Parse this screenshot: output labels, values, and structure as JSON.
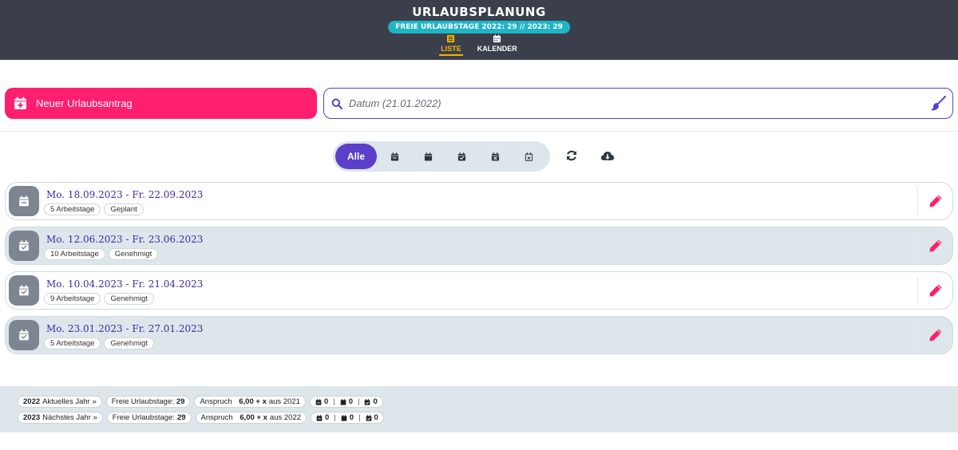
{
  "header": {
    "title": "URLAUBSPLANUNG",
    "badge": "FREIE URLAUBSTAGE 2022: 29 // 2023: 29",
    "nav": [
      {
        "label": "LISTE",
        "icon": "list-icon",
        "active": true
      },
      {
        "label": "KALENDER",
        "icon": "calendar-icon",
        "active": false
      }
    ]
  },
  "toolbar": {
    "new_label": "Neuer Urlaubsantrag",
    "search_placeholder": "Datum (21.01.2022)",
    "search_value": ""
  },
  "filters": {
    "all_label": "Alle",
    "icons": [
      "calendar-minus-icon",
      "calendar-icon",
      "calendar-check-icon",
      "calendar-x-icon",
      "calendar-x-outline-icon"
    ]
  },
  "actions": {
    "refresh_icon": "refresh-icon",
    "download_icon": "cloud-download-icon"
  },
  "list": [
    {
      "title": "Mo. 18.09.2023 - Fr. 22.09.2023",
      "days": "5 Arbeitstage",
      "status": "Geplant",
      "icon": "calendar-minus-icon"
    },
    {
      "title": "Mo. 12.06.2023 - Fr. 23.06.2023",
      "days": "10 Arbeitstage",
      "status": "Genehmigt",
      "icon": "calendar-check-icon"
    },
    {
      "title": "Mo. 10.04.2023 - Fr. 21.04.2023",
      "days": "9 Arbeitstage",
      "status": "Genehmigt",
      "icon": "calendar-check-icon"
    },
    {
      "title": "Mo. 23.01.2023 - Fr. 27.01.2023",
      "days": "5 Arbeitstage",
      "status": "Genehmigt",
      "icon": "calendar-check-icon"
    }
  ],
  "footer": {
    "rows": [
      {
        "year": "2022",
        "year_label": "Aktuelles Jahr »",
        "free_label": "Freie Urlaubstage:",
        "free_value": "29",
        "claim_label": "Anspruch",
        "claim_value": "6,00 + x",
        "claim_suffix": "aus 2021",
        "c1": "0",
        "c2": "0",
        "c3": "0"
      },
      {
        "year": "2023",
        "year_label": "Nächstes Jahr »",
        "free_label": "Freie Urlaubstage:",
        "free_value": "29",
        "claim_label": "Anspruch",
        "claim_value": "6,00 + x",
        "claim_suffix": "aus 2022",
        "c1": "0",
        "c2": "0",
        "c3": "0"
      }
    ]
  },
  "colors": {
    "header_bg": "#3a3f4b",
    "badge_bg": "#1fb4c6",
    "accent_pink": "#ff1f6e",
    "accent_purple": "#5b3fc9",
    "active_nav": "#f4b400",
    "alt_row_bg": "#dde6ea"
  }
}
